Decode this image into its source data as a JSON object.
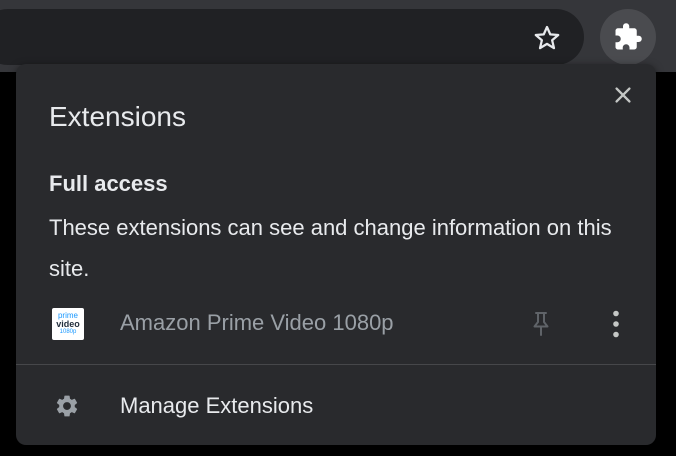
{
  "toolbar": {
    "bookmark_icon": "star-outline-icon",
    "extensions_icon": "puzzle-piece-icon"
  },
  "popup": {
    "title": "Extensions",
    "close_icon": "close-icon",
    "section": {
      "title": "Full access",
      "description": "These extensions can see and change information on this site."
    },
    "extensions": [
      {
        "name": "Amazon Prime Video 1080p",
        "logo_lines": [
          "prime",
          "video",
          "1080p"
        ],
        "pin_icon": "pin-icon",
        "menu_icon": "more-vert-icon"
      }
    ],
    "manage": {
      "label": "Manage Extensions",
      "icon": "gear-icon"
    }
  },
  "colors": {
    "toolbar_bg": "#35363a",
    "omnibox_bg": "#202124",
    "popup_bg": "#292a2d",
    "text_primary": "#e8eaed",
    "text_secondary": "#9aa0a6",
    "divider": "#46474a"
  }
}
